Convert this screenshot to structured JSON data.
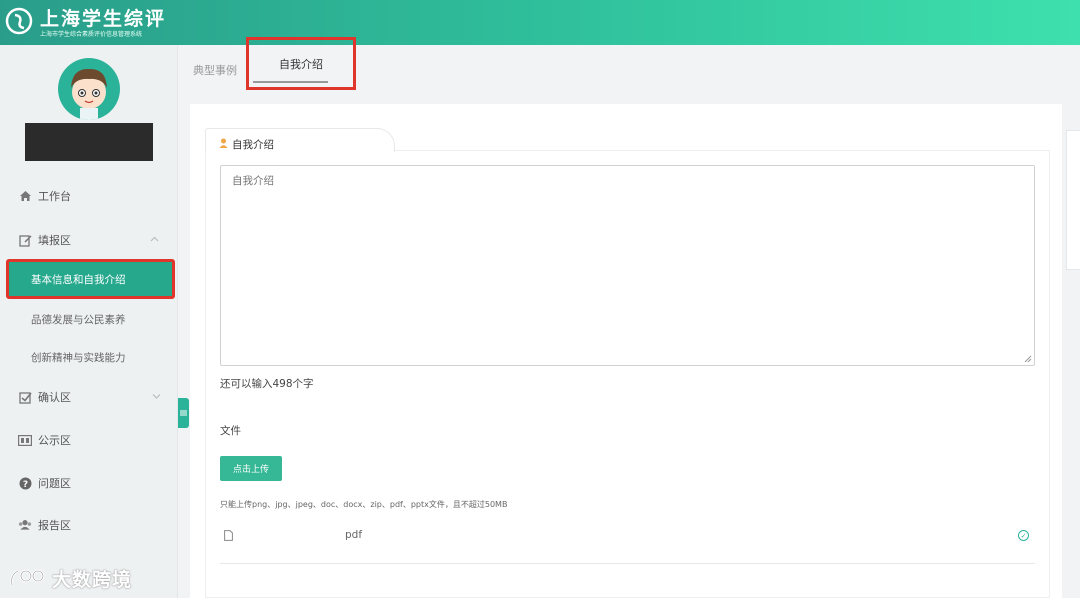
{
  "header": {
    "app_title": "上海学生综评",
    "app_subtitle": "上海市学生综合素质评价信息管理系统"
  },
  "sidebar": {
    "items": [
      {
        "label": "工作台",
        "icon": "home-icon"
      },
      {
        "label": "填报区",
        "icon": "edit-icon"
      },
      {
        "label": "确认区",
        "icon": "checkbox-icon"
      },
      {
        "label": "公示区",
        "icon": "board-icon"
      },
      {
        "label": "问题区",
        "icon": "question-icon"
      },
      {
        "label": "报告区",
        "icon": "users-icon"
      }
    ],
    "sub_items": [
      {
        "label": "基本信息和自我介绍",
        "active": true
      },
      {
        "label": "品德发展与公民素养",
        "active": false
      },
      {
        "label": "创新精神与实践能力",
        "active": false
      }
    ]
  },
  "tabs": [
    {
      "label": "典型事例",
      "active": false
    },
    {
      "label": "自我介绍",
      "active": true
    }
  ],
  "form": {
    "section_title": "自我介绍",
    "textarea_placeholder": "自我介绍",
    "counter": "还可以输入498个字",
    "file_label": "文件",
    "upload_button": "点击上传",
    "hint": "只能上传png、jpg、jpeg、doc、docx、zip、pdf、pptx文件，且不超过50MB",
    "file_name": "pdf"
  },
  "watermark": {
    "text": "大数跨境"
  },
  "colors": {
    "brand": "#2bb39a",
    "highlight_box": "#e0352b"
  }
}
